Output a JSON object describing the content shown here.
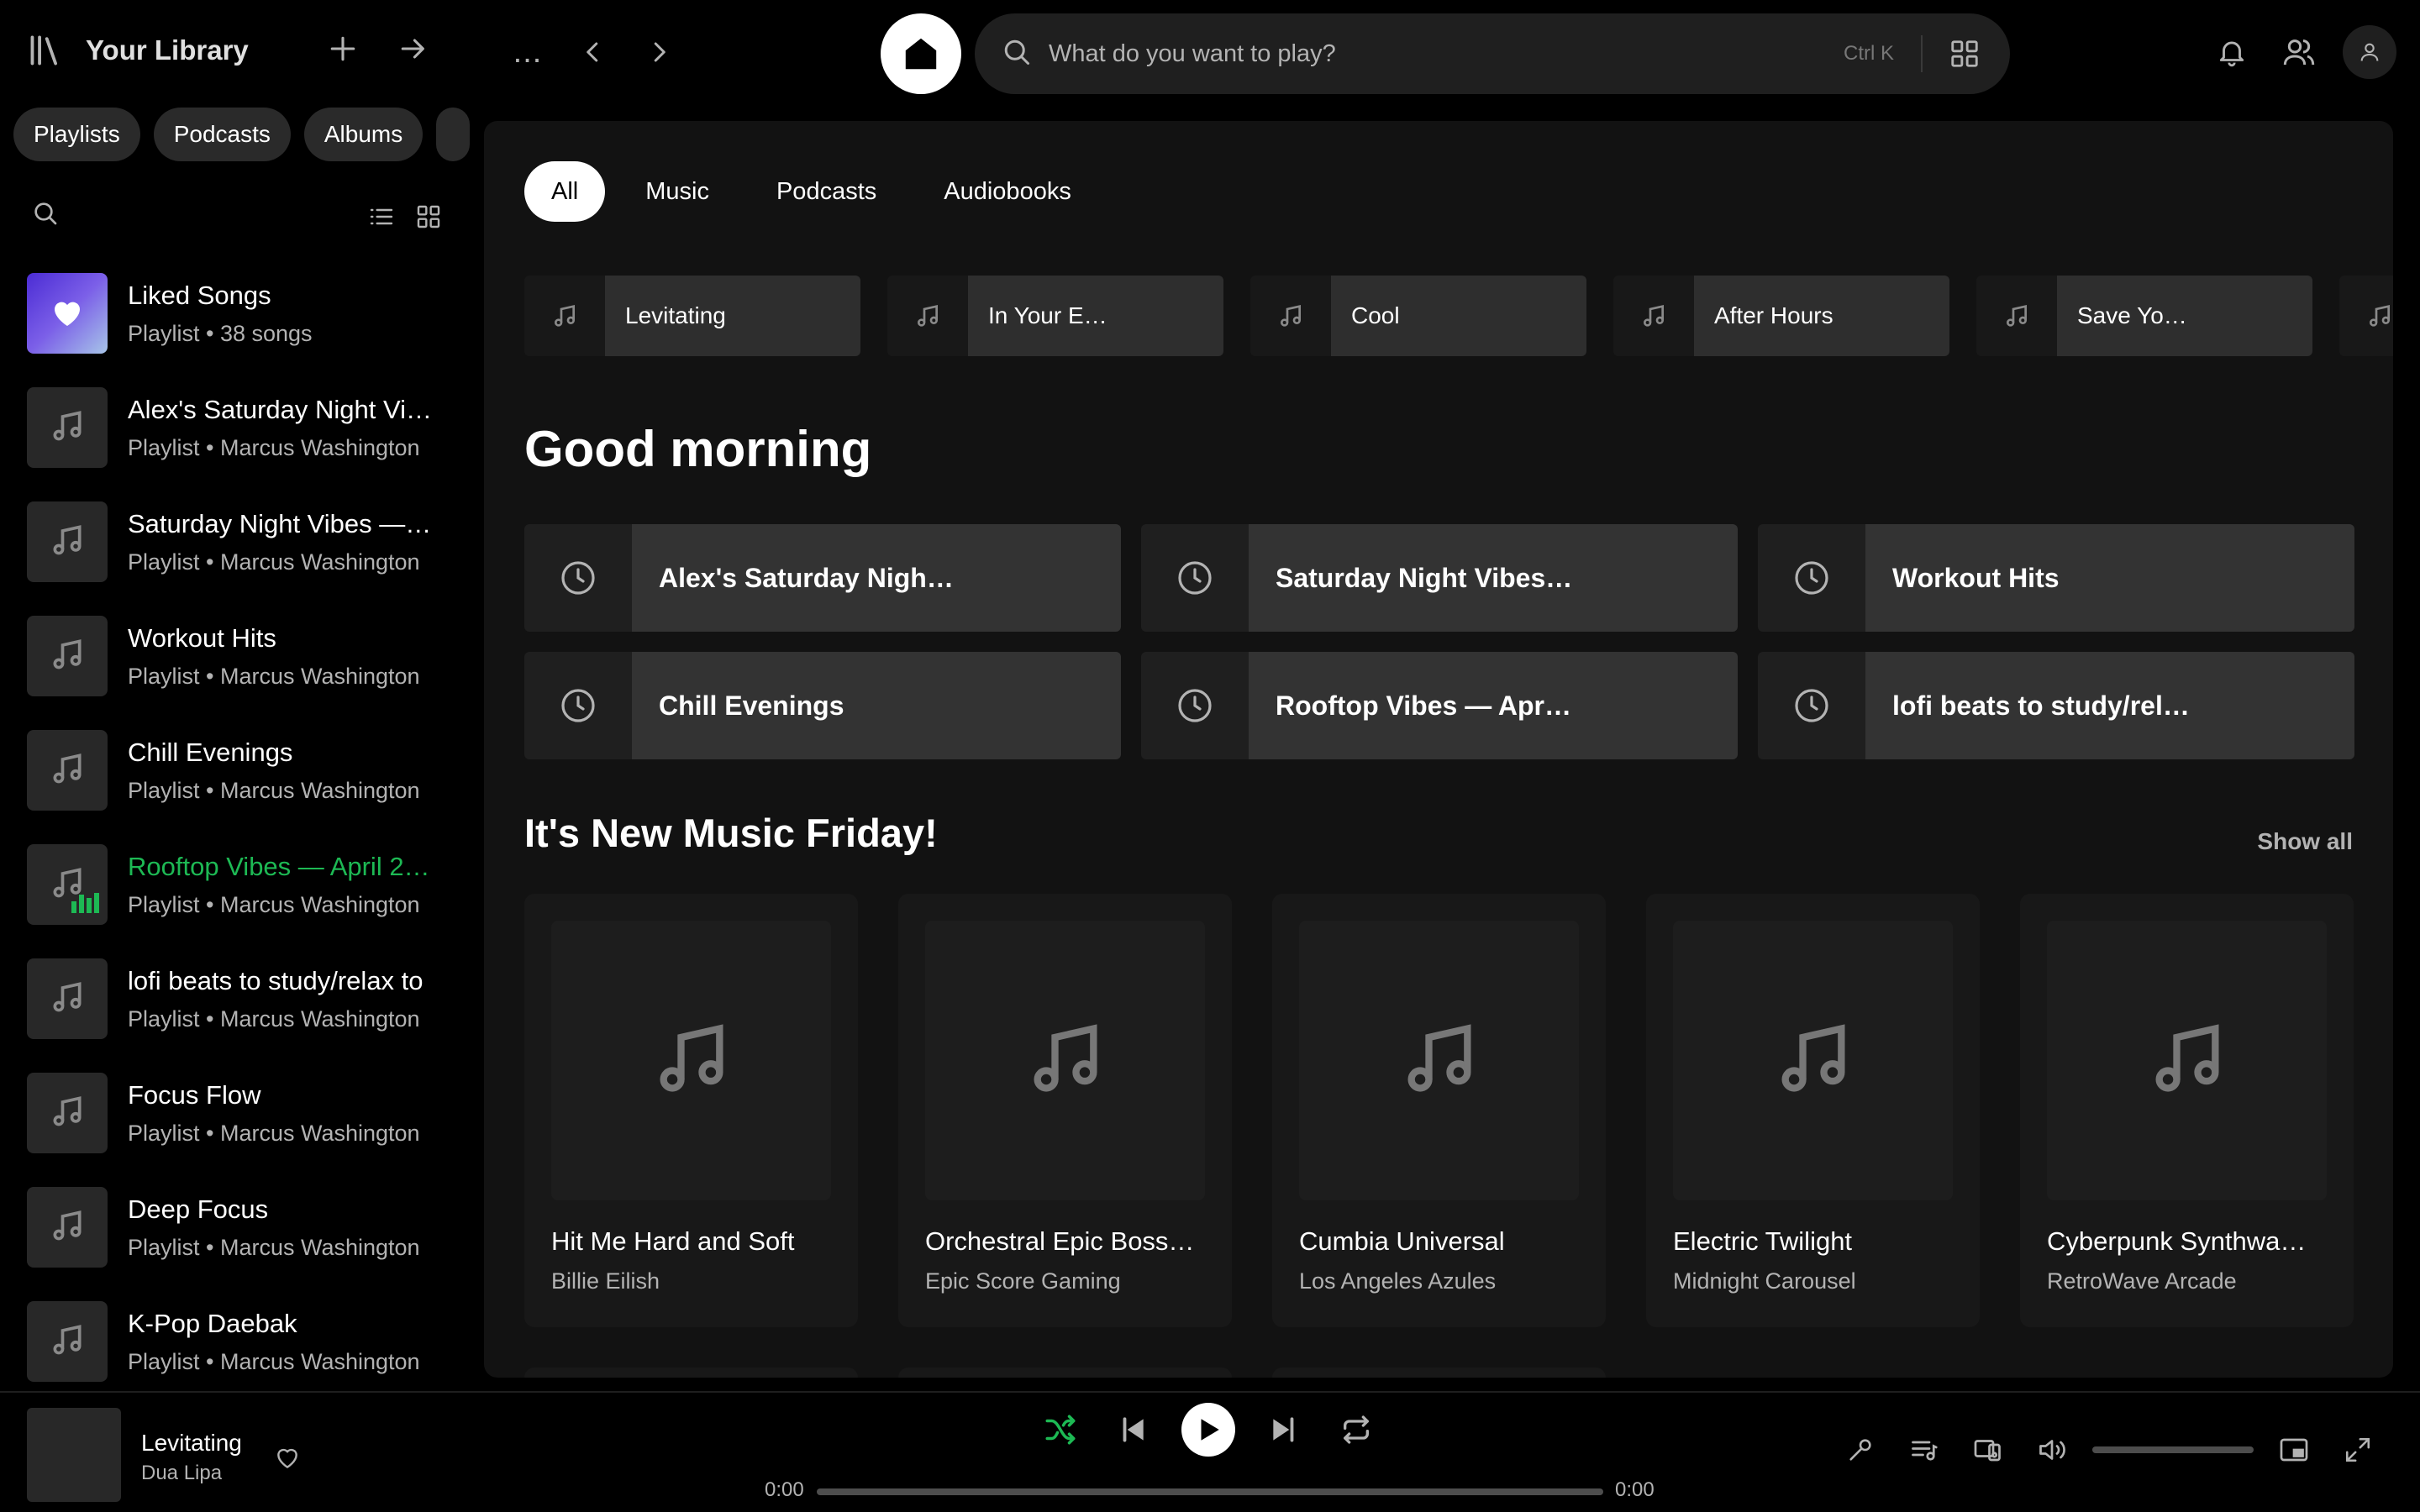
{
  "sidebar": {
    "title": "Your Library",
    "chips": [
      "Playlists",
      "Podcasts",
      "Albums"
    ],
    "items": [
      {
        "name": "Liked Songs",
        "sub": "Playlist • 38 songs",
        "liked": true,
        "active": false
      },
      {
        "name": "Alex's Saturday Night Vi…",
        "sub": "Playlist • Marcus Washington",
        "liked": false,
        "active": false
      },
      {
        "name": "Saturday Night Vibes —…",
        "sub": "Playlist • Marcus Washington",
        "liked": false,
        "active": false
      },
      {
        "name": "Workout Hits",
        "sub": "Playlist • Marcus Washington",
        "liked": false,
        "active": false
      },
      {
        "name": "Chill Evenings",
        "sub": "Playlist • Marcus Washington",
        "liked": false,
        "active": false
      },
      {
        "name": "Rooftop Vibes — April 2…",
        "sub": "Playlist • Marcus Washington",
        "liked": false,
        "active": true
      },
      {
        "name": "lofi beats to study/relax to",
        "sub": "Playlist • Marcus Washington",
        "liked": false,
        "active": false
      },
      {
        "name": "Focus Flow",
        "sub": "Playlist • Marcus Washington",
        "liked": false,
        "active": false
      },
      {
        "name": "Deep Focus",
        "sub": "Playlist • Marcus Washington",
        "liked": false,
        "active": false
      },
      {
        "name": "K-Pop Daebak",
        "sub": "Playlist • Marcus Washington",
        "liked": false,
        "active": false
      }
    ]
  },
  "topbar": {
    "dots": "...",
    "search_placeholder": "What do you want to play?",
    "shortcut": "Ctrl K"
  },
  "main": {
    "filters": [
      {
        "label": "All",
        "active": true
      },
      {
        "label": "Music",
        "active": false
      },
      {
        "label": "Podcasts",
        "active": false
      },
      {
        "label": "Audiobooks",
        "active": false
      }
    ],
    "recent": [
      "Levitating",
      "In Your E…",
      "Cool",
      "After Hours",
      "Save Yo…"
    ],
    "greeting": "Good morning",
    "quick": [
      "Alex's Saturday Nigh…",
      "Saturday Night Vibes…",
      "Workout Hits",
      "Chill Evenings",
      "Rooftop Vibes — Apr…",
      "lofi beats to study/rel…"
    ],
    "section_title": "It's New Music Friday!",
    "show_all": "Show all",
    "cards": [
      {
        "title": "Hit Me Hard and Soft",
        "artist": "Billie Eilish"
      },
      {
        "title": "Orchestral Epic Boss…",
        "artist": "Epic Score Gaming"
      },
      {
        "title": "Cumbia Universal",
        "artist": "Los Angeles Azules"
      },
      {
        "title": "Electric Twilight",
        "artist": "Midnight Carousel"
      },
      {
        "title": "Cyberpunk Synthwa…",
        "artist": "RetroWave Arcade"
      }
    ]
  },
  "player": {
    "title": "Levitating",
    "artist": "Dua Lipa",
    "elapsed": "0:00",
    "duration": "0:00",
    "progress": 0,
    "volume": 0,
    "shuffle_on": true
  },
  "colors": {
    "accent": "#1db954",
    "background": "#121212",
    "surface": "#181818",
    "text_secondary": "#b3b3b3"
  }
}
